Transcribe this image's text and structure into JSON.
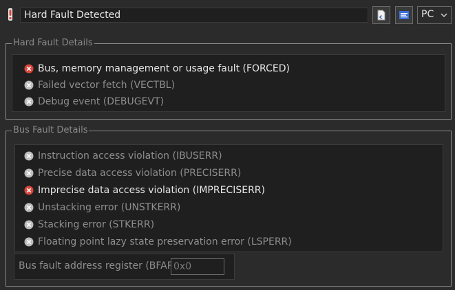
{
  "header": {
    "title": "Hard Fault Detected",
    "view_mode": "PC",
    "icons": [
      "warning-icon",
      "c-source-icon",
      "disassembly-icon",
      "chevron-down-icon"
    ]
  },
  "hard_fault": {
    "group_label": "Hard Fault Details",
    "items": [
      {
        "label": "Bus, memory management or usage fault (FORCED)",
        "active": true
      },
      {
        "label": "Failed vector fetch (VECTBL)",
        "active": false
      },
      {
        "label": "Debug event (DEBUGEVT)",
        "active": false
      }
    ]
  },
  "bus_fault": {
    "group_label": "Bus Fault Details",
    "items": [
      {
        "label": "Instruction access violation (IBUSERR)",
        "active": false
      },
      {
        "label": "Precise data access violation (PRECISERR)",
        "active": false
      },
      {
        "label": "Imprecise data access violation (IMPRECISERR)",
        "active": true
      },
      {
        "label": "Unstacking error (UNSTKERR)",
        "active": false
      },
      {
        "label": "Stacking error (STKERR)",
        "active": false
      },
      {
        "label": "Floating point lazy state preservation error (LSPERR)",
        "active": false
      }
    ],
    "bfar_label": "Bus fault address register (BFAR):",
    "bfar_value": "0x0"
  },
  "colors": {
    "active_icon": "#d9473d",
    "inactive_icon": "#bdbdbd",
    "background": "#2b2b2b",
    "panel": "#1f1f1f"
  }
}
